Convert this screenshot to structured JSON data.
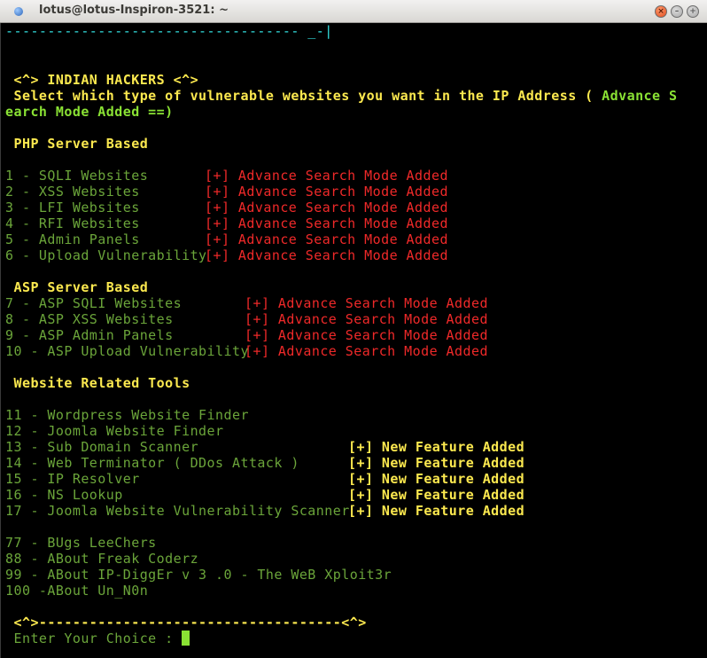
{
  "window": {
    "title": "lotus@lotus-Inspiron-3521: ~",
    "close_glyph": "×",
    "min_glyph": "–",
    "max_glyph": "+"
  },
  "colors": {
    "background": "#000000",
    "cyan": "#34e2e2",
    "yellow": "#fce94f",
    "green": "#8ae234",
    "menu_green": "#6ba53a",
    "red": "#ef2929"
  },
  "terminal": {
    "top_rule": "----------------------------------- _-|",
    "banner": " <^> INDIAN HACKERS <^>",
    "prompt_line1_a": " Select which type of vulnerable websites you want in the IP Address ( ",
    "prompt_line1_b": "Advance S",
    "prompt_line2": "earch Mode Added ==)",
    "php_header": " PHP Server Based",
    "php_items": [
      "1 - SQLI Websites",
      "2 - XSS Websites",
      "3 - LFI Websites",
      "4 - RFI Websites",
      "5 - Admin Panels",
      "6 - Upload Vulnerability"
    ],
    "advance_tag": "[+] Advance Search Mode Added",
    "asp_header": " ASP Server Based",
    "asp_items": [
      "7 - ASP SQLI Websites",
      "8 - ASP XSS Websites",
      "9 - ASP Admin Panels",
      "10 - ASP Upload Vulnerability"
    ],
    "tools_header": " Website Related Tools",
    "tools_items": [
      "11 - Wordpress Website Finder",
      "12 - Joomla Website Finder",
      "13 - Sub Domain Scanner",
      "14 - Web Terminator ( DDos Attack )",
      "15 - IP Resolver",
      "16 - NS Lookup",
      "17 - Joomla Website Vulnerability Scanner"
    ],
    "feature_tag": "[+] New Feature Added",
    "about_items": [
      "77 - BUgs LeeChers",
      "88 - ABout Freak Coderz",
      "99 - ABout IP-DiggEr v 3 .0 - The WeB Xploit3r",
      "100 -ABout Un_N0n"
    ],
    "bottom_rule": " <^>------------------------------------<^>",
    "input_prompt": " Enter Your Choice : "
  }
}
